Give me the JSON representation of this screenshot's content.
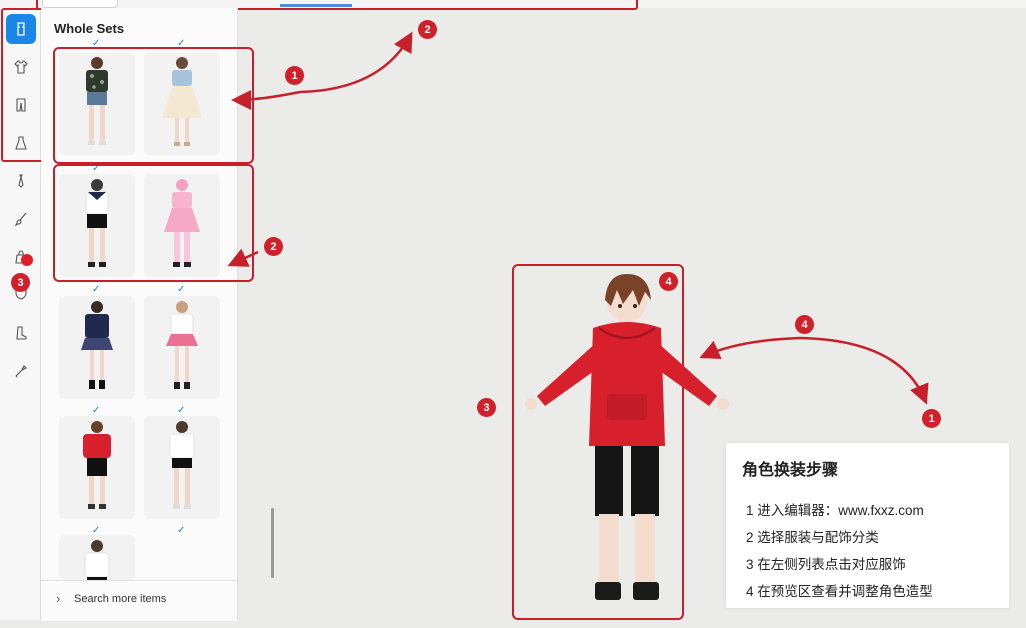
{
  "panel": {
    "title": "Whole Sets",
    "search_label": "Search more items",
    "search_icon": "chevron-right-icon"
  },
  "rail": {
    "items": [
      {
        "icon": "whole-set-icon",
        "active": true
      },
      {
        "icon": "shirt-icon",
        "active": false
      },
      {
        "icon": "pants-icon",
        "active": false
      },
      {
        "icon": "dress-icon",
        "active": false
      },
      {
        "icon": "tie-icon",
        "active": false
      },
      {
        "icon": "brush-icon",
        "active": false
      },
      {
        "icon": "bag-icon",
        "active": false
      },
      {
        "icon": "shield-icon",
        "active": false
      },
      {
        "icon": "boot-icon",
        "active": false
      },
      {
        "icon": "tool-icon",
        "active": false
      }
    ]
  },
  "outfits": [
    {
      "name": "floral-shirt-shorts"
    },
    {
      "name": "denim-jacket-white-skirt"
    },
    {
      "name": "sailor-black-shorts"
    },
    {
      "name": "pink-maid-dress"
    },
    {
      "name": "navy-school-uniform"
    },
    {
      "name": "pink-plaid-skirt"
    },
    {
      "name": "red-hoodie-black-shorts"
    },
    {
      "name": "white-tee-black-shorts"
    },
    {
      "name": "white-tee-partial"
    }
  ],
  "annotations": {
    "badges": [
      "1",
      "2",
      "2",
      "3",
      "3",
      "4",
      "4",
      "1"
    ]
  },
  "info": {
    "title": "角色换装步骤",
    "steps": [
      "1  进入编辑器：www.fxxz.com",
      "2  选择服装与配饰分类",
      "3  在左侧列表点击对应服饰",
      "4  在预览区查看并调整角色造型"
    ]
  },
  "colors": {
    "accent": "#1a86e8",
    "annotation_red": "#c7202a",
    "hoodie_red": "#d8202c",
    "canvas": "#ebebea"
  }
}
